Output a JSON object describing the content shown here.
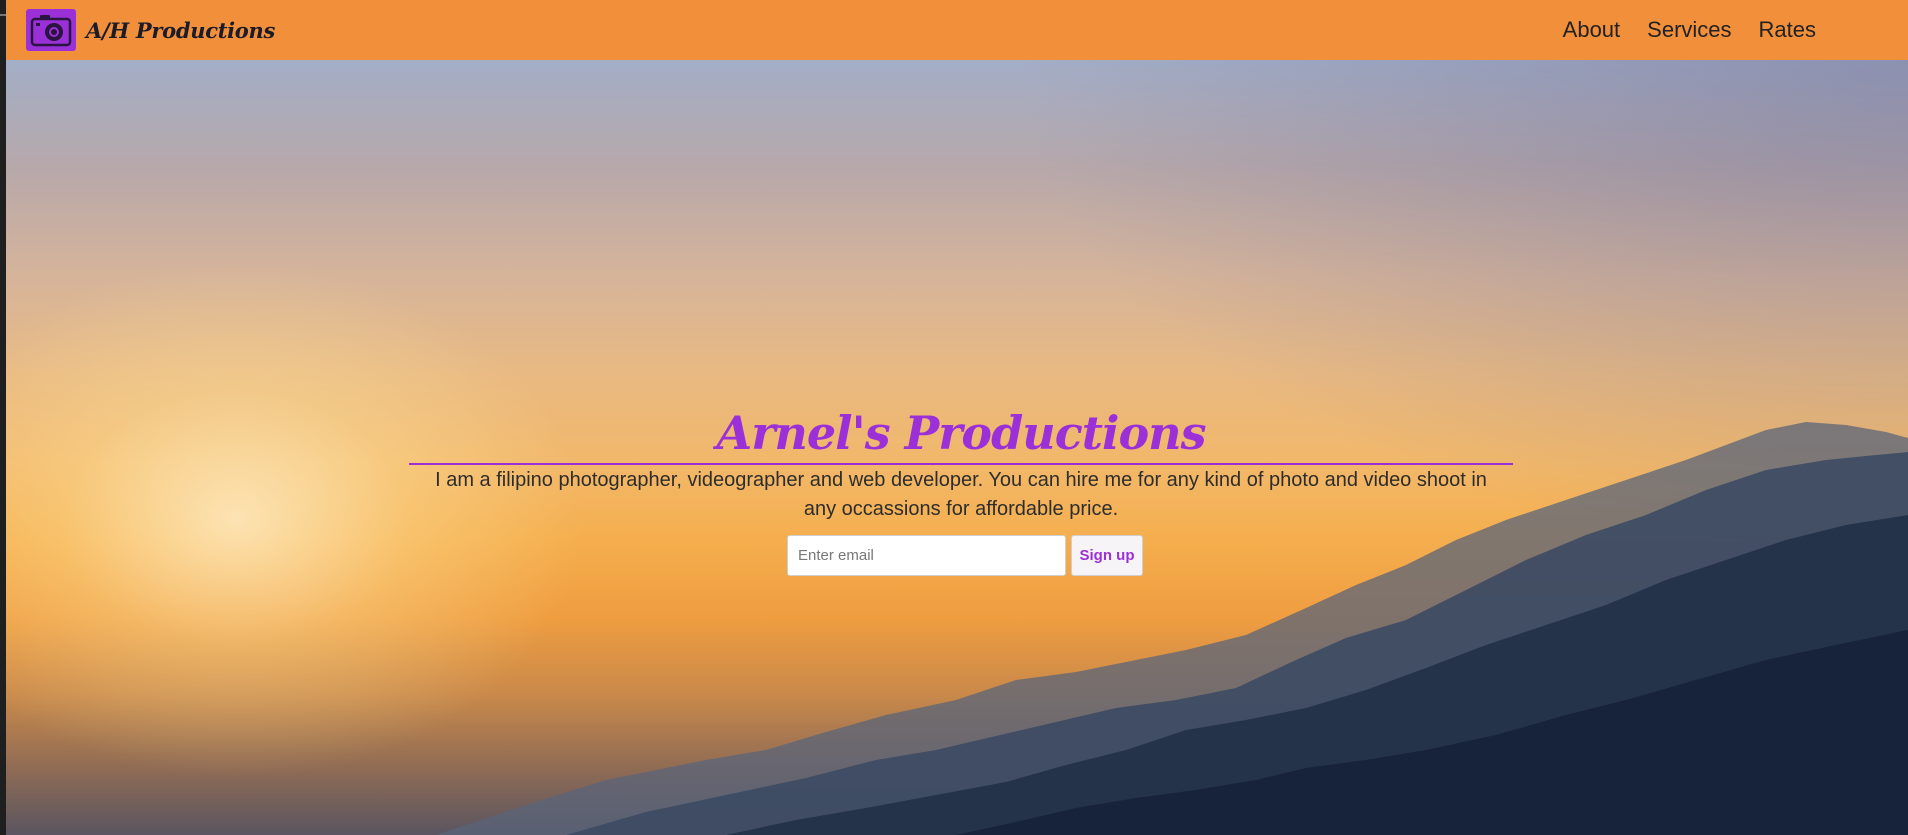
{
  "brand": {
    "name": "A/H Productions",
    "logo_icon": "camera-icon"
  },
  "nav": {
    "items": [
      {
        "label": "About"
      },
      {
        "label": "Services"
      },
      {
        "label": "Rates"
      }
    ]
  },
  "hero": {
    "title": "Arnel's Productions",
    "description": "I am a filipino photographer, videographer and web developer. You can hire me for any kind of photo and video shoot in any occassions for affordable price.",
    "email_placeholder": "Enter email",
    "signup_label": "Sign up",
    "background": "sunset-mountains-image"
  },
  "colors": {
    "navbar": "#f28f3b",
    "accent": "#9b30d9",
    "text": "#2d2d2d"
  }
}
